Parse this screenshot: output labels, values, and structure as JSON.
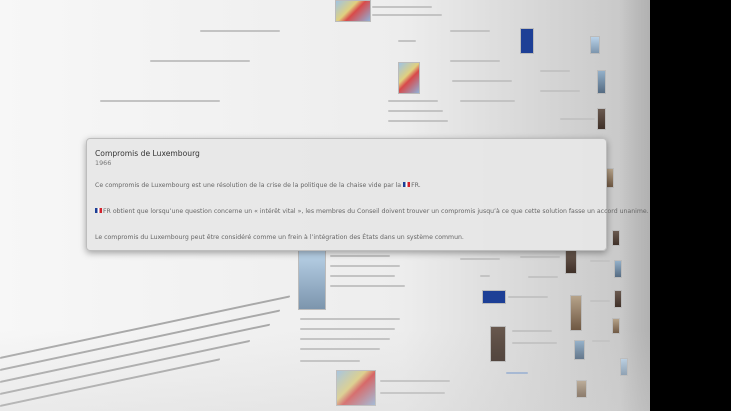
{
  "popup": {
    "title": "Compromis de Luxembourg",
    "year": "1966",
    "para1_text": "Ce compromis de Luxembourg est une résolution de la crise de la politique de la chaise vide par la",
    "para1_country": "FR",
    "para1_end": ".",
    "para2_country": "FR",
    "para2_text": " obtient que lorsqu’une question concerne un « intérêt vital », les membres du Conseil doivent trouver un compromis jusqu’à ce que cette solution fasse un accord unanime.",
    "para3_text": "Le compromis du Luxembourg peut être considéré comme un frein à l’intégration des États dans un système commun."
  },
  "icons": {
    "flag_fr": "flag-france-icon"
  },
  "colors": {
    "popup_bg": "#e7e7e7",
    "flag_blue": "#1c3f96",
    "flag_red": "#d3222c"
  }
}
